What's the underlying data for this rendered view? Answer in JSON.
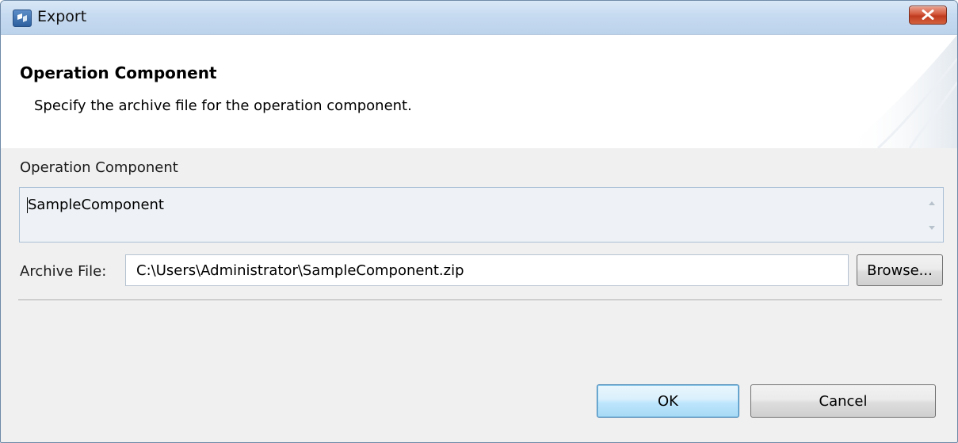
{
  "window": {
    "title": "Export",
    "close_icon": "close-icon",
    "app_icon": "app-icon"
  },
  "header": {
    "title": "Operation Component",
    "description": "Specify the archive file for the operation component."
  },
  "component": {
    "label": "Operation Component",
    "value": "SampleComponent"
  },
  "archive": {
    "label": "Archive File:",
    "value": "C:\\Users\\Administrator\\SampleComponent.zip",
    "browse_label": "Browse..."
  },
  "buttons": {
    "ok_label": "OK",
    "cancel_label": "Cancel"
  },
  "colors": {
    "close_button": "#c94a2f",
    "title_bar": "#c6daf0",
    "default_button_border": "#3c7fb1"
  }
}
